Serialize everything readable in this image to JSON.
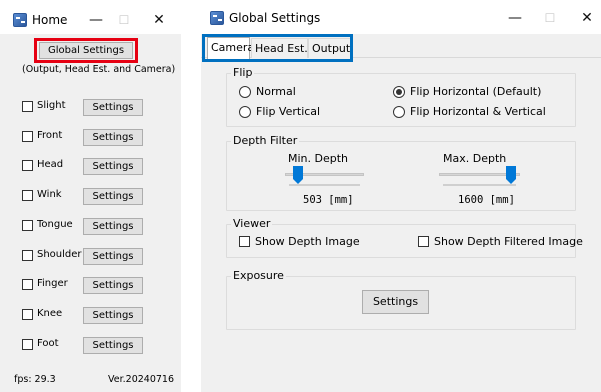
{
  "home": {
    "title": "Home",
    "controls": {
      "minimize": "—",
      "maximize": "☐",
      "close": "✕"
    },
    "global_settings_button": "Global Settings",
    "subtitle": "(Output, Head Est. and Camera)",
    "rows": [
      {
        "label": "Slight",
        "checked": false,
        "button": "Settings"
      },
      {
        "label": "Front",
        "checked": false,
        "button": "Settings"
      },
      {
        "label": "Head",
        "checked": false,
        "button": "Settings"
      },
      {
        "label": "Wink",
        "checked": false,
        "button": "Settings"
      },
      {
        "label": "Tongue",
        "checked": false,
        "button": "Settings"
      },
      {
        "label": "Shoulder",
        "checked": false,
        "button": "Settings"
      },
      {
        "label": "Finger",
        "checked": false,
        "button": "Settings"
      },
      {
        "label": "Knee",
        "checked": false,
        "button": "Settings"
      },
      {
        "label": "Foot",
        "checked": false,
        "button": "Settings"
      }
    ],
    "fps": "fps: 29.3",
    "version": "Ver.20240716"
  },
  "global": {
    "title": "Global Settings",
    "controls": {
      "minimize": "—",
      "maximize": "☐",
      "close": "✕"
    },
    "tabs": [
      {
        "label": "Camera",
        "active": true
      },
      {
        "label": "Head Est.",
        "active": false
      },
      {
        "label": "Output",
        "active": false
      }
    ],
    "flip": {
      "title": "Flip",
      "options": [
        {
          "label": "Normal",
          "checked": false
        },
        {
          "label": "Flip Horizontal (Default)",
          "checked": true
        },
        {
          "label": "Flip Vertical",
          "checked": false
        },
        {
          "label": "Flip Horizontal & Vertical",
          "checked": false
        }
      ]
    },
    "depth_filter": {
      "title": "Depth Filter",
      "min_label": "Min. Depth",
      "max_label": "Max. Depth",
      "min_value": "503 [mm]",
      "max_value": "1600 [mm]",
      "min_level": 0.12,
      "max_level": 0.95
    },
    "viewer": {
      "title": "Viewer",
      "show_depth_image": "Show Depth Image",
      "show_depth_filtered_image": "Show Depth Filtered Image"
    },
    "exposure": {
      "title": "Exposure",
      "settings_button": "Settings"
    }
  },
  "colors": {
    "window_bg": "#f0f0f0",
    "red_highlight": "#e60012",
    "blue_highlight": "#0070c0",
    "slider_thumb": "#0078d7"
  }
}
